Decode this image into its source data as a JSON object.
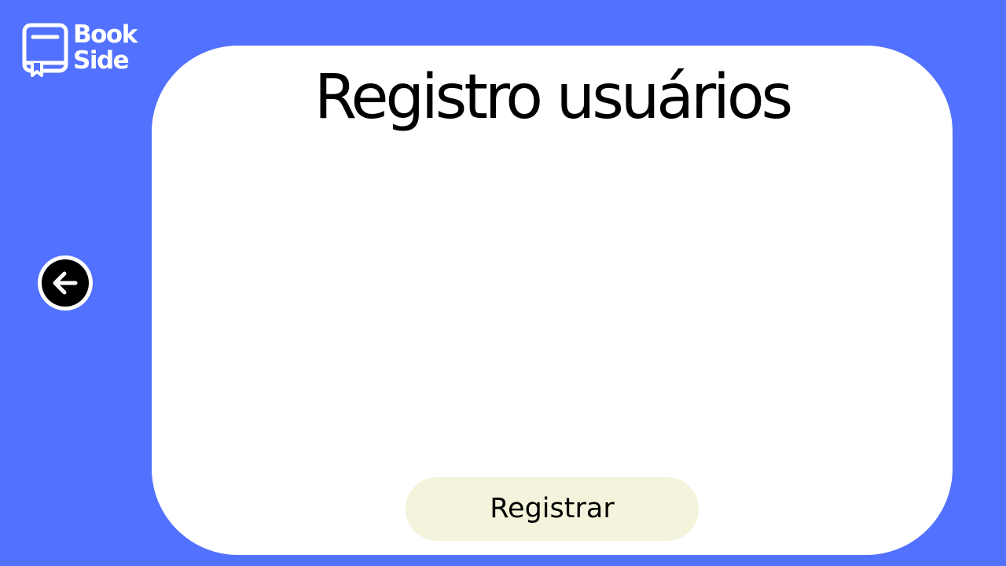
{
  "logo": {
    "line1": "Book",
    "line2": "Side",
    "icon": "book-icon"
  },
  "nav": {
    "back_icon": "arrow-left-icon"
  },
  "card": {
    "title": "Registro usuários"
  },
  "actions": {
    "register_label": "Registrar"
  },
  "colors": {
    "background": "#5271ff",
    "card": "#ffffff",
    "button": "#f4f4dc",
    "text": "#000000"
  }
}
